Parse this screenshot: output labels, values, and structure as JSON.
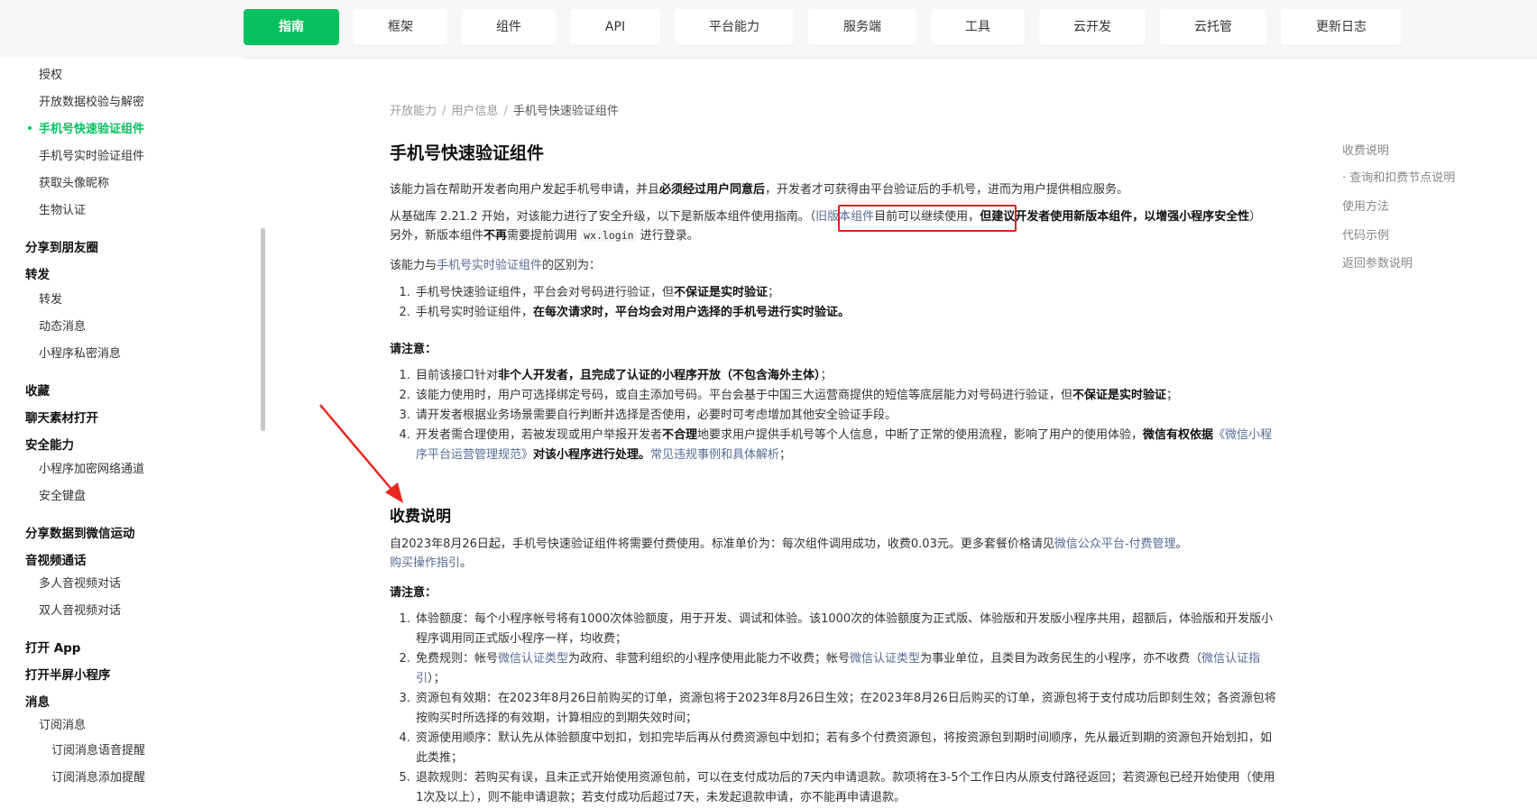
{
  "nav": {
    "items": [
      {
        "label": "指南",
        "active": true
      },
      {
        "label": "框架"
      },
      {
        "label": "组件"
      },
      {
        "label": "API"
      },
      {
        "label": "平台能力"
      },
      {
        "label": "服务端"
      },
      {
        "label": "工具"
      },
      {
        "label": "云开发"
      },
      {
        "label": "云托管"
      },
      {
        "label": "更新日志"
      }
    ]
  },
  "sidebar": {
    "items": [
      {
        "label": "授权",
        "level": 2
      },
      {
        "label": "开放数据校验与解密",
        "level": 2
      },
      {
        "label": "手机号快速验证组件",
        "level": 2,
        "active": true
      },
      {
        "label": "手机号实时验证组件",
        "level": 2
      },
      {
        "label": "获取头像昵称",
        "level": 2
      },
      {
        "label": "生物认证",
        "level": 2
      },
      {
        "label": "分享到朋友圈",
        "level": 1
      },
      {
        "label": "转发",
        "level": 1
      },
      {
        "label": "转发",
        "level": 2
      },
      {
        "label": "动态消息",
        "level": 2
      },
      {
        "label": "小程序私密消息",
        "level": 2
      },
      {
        "label": "收藏",
        "level": 1
      },
      {
        "label": "聊天素材打开",
        "level": 1
      },
      {
        "label": "安全能力",
        "level": 1
      },
      {
        "label": "小程序加密网络通道",
        "level": 2
      },
      {
        "label": "安全键盘",
        "level": 2
      },
      {
        "label": "分享数据到微信运动",
        "level": 1
      },
      {
        "label": "音视频通话",
        "level": 1
      },
      {
        "label": "多人音视频对话",
        "level": 2
      },
      {
        "label": "双人音视频对话",
        "level": 2
      },
      {
        "label": "打开 App",
        "level": 1
      },
      {
        "label": "打开半屏小程序",
        "level": 1
      },
      {
        "label": "消息",
        "level": 1
      },
      {
        "label": "订阅消息",
        "level": 2
      },
      {
        "label": "订阅消息语音提醒",
        "level": 3
      },
      {
        "label": "订阅消息添加提醒",
        "level": 3
      }
    ]
  },
  "breadcrumb": {
    "items": [
      "开放能力",
      "用户信息",
      "手机号快速验证组件"
    ],
    "sep": "/"
  },
  "page": {
    "title": "手机号快速验证组件",
    "intro": {
      "a": "该能力旨在帮助开发者向用户发起手机号申请，并且",
      "b": "必须经过用户同意后",
      "c": "，开发者才可获得由平台验证后的手机号，进而为用户提供相应服务。"
    },
    "upgrade": {
      "a": "从基础库 2.21.2 开始，对该能力进行了安全升级，以下是新版本组件使用指南。",
      "b": "（",
      "link": "旧版本组件",
      "c": "目前可以继续使用",
      "d": "，",
      "e": "但建议开发者使用新版本组件，以增强小程序安全性",
      "f": "）另外，新版本组件",
      "g": "不再",
      "h": "需要提前调用 ",
      "code": "wx.login",
      "i": " 进行登录。"
    },
    "diff": {
      "a": "该能力与",
      "link": "手机号实时验证组件",
      "b": "的区别为："
    },
    "diff_list": [
      {
        "a": "手机号快速验证组件，平台会对号码进行验证，但",
        "b": "不保证是实时验证",
        "c": "；"
      },
      {
        "a": "手机号实时验证组件，",
        "b": "在每次请求时，平台均会对用户选择的手机号进行实时验证。",
        "c": ""
      }
    ],
    "note1": "请注意：",
    "notes": [
      {
        "a": "目前该接口针对",
        "b": "非个人开发者，且完成了认证的小程序开放（不包含海外主体）",
        "c": "；"
      },
      {
        "a": "该能力使用时，用户可选择绑定号码，或自主添加号码。平台会基于中国三大运营商提供的短信等底层能力对号码进行验证，但",
        "b": "不保证是实时验证",
        "c": "；"
      },
      {
        "a": "请开发者根据业务场景需要自行判断并选择是否使用，必要时可考虑增加其他安全验证手段。",
        "b": "",
        "c": ""
      },
      {
        "a": "开发者需合理使用，若被发现或用户举报开发者",
        "b": "不合理",
        "c": "地要求用户提供手机号等个人信息，中断了正常的使用流程，影响了用户的使用体验，",
        "d": "微信有权依据",
        "link": "《微信小程序平台运营管理规范》",
        "e": "对该小程序进行处理。",
        "link2": "常见违规事例和具体解析",
        "f": "；"
      }
    ],
    "fee": {
      "title": "收费说明",
      "p_a": "自2023年8月26日起，手机号快速验证组件将需要付费使用。标准单价为：每次组件调用成功，收费0.03元。更多套餐价格请见",
      "p_link": "微信公众平台-付费管理",
      "p_b": "。",
      "p_link2": "购买操作指引",
      "p_c": "。",
      "note": "请注意：",
      "items": [
        {
          "a": "体验额度：每个小程序帐号将有1000次体验额度，用于开发、调试和体验。该1000次的体验额度为正式版、体验版和开发版小程序共用，超额后，体验版和开发版小程序调用同正式版小程序一样，均收费；"
        },
        {
          "a": "免费规则：帐号",
          "link": "微信认证类型",
          "b": "为政府、非营利组织的小程序使用此能力不收费；帐号",
          "link2": "微信认证类型",
          "c": "为事业单位，且类目为政务民生的小程序，亦不收费（",
          "link3": "微信认证指引",
          "d": "）；"
        },
        {
          "a": "资源包有效期：在2023年8月26日前购买的订单，资源包将于2023年8月26日生效；在2023年8月26日后购买的订单，资源包将于支付成功后即刻生效；各资源包将按购买时所选择的有效期，计算相应的到期失效时间；"
        },
        {
          "a": "资源使用顺序：默认先从体验额度中划扣，划扣完毕后再从付费资源包中划扣；若有多个付费资源包，将按资源包到期时间顺序，先从最近到期的资源包开始划扣，如此类推；"
        },
        {
          "a": "退款规则：若购买有误，且未正式开始使用资源包前，可以在支付成功后的7天内申请退款。款项将在3-5个工作日内从原支付路径返回；若资源包已经开始使用（使用1次及以上），则不能申请退款；若支付成功后超过7天，未发起退款申请，亦不能再申请退款。"
        }
      ]
    }
  },
  "toc": {
    "items": [
      "收费说明",
      "· 查询和扣费节点说明",
      "使用方法",
      "代码示例",
      "返回参数说明"
    ]
  },
  "colors": {
    "accent": "#07c160",
    "link": "#576b95",
    "highlight_box": "#e02020",
    "arrow": "#e8281e"
  }
}
